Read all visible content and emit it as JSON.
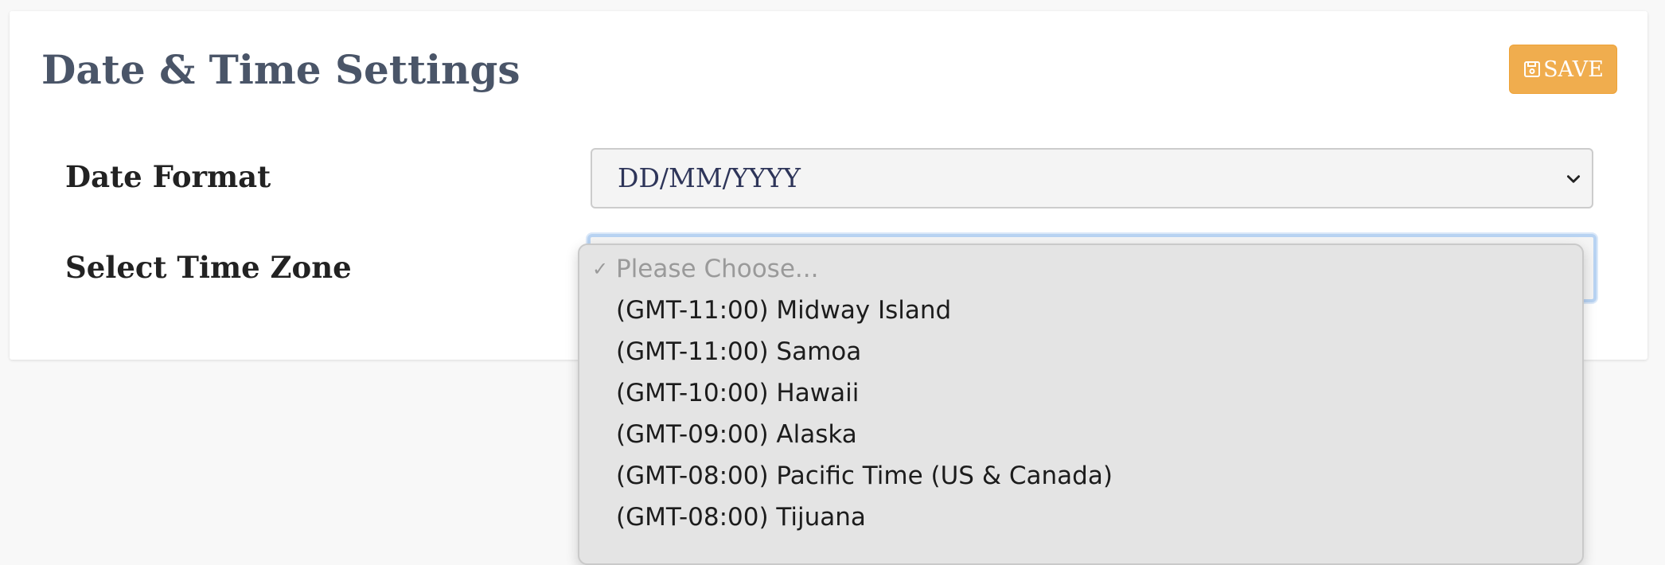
{
  "header": {
    "title": "Date & Time Settings",
    "save_label": "SAVE",
    "save_icon": "floppy-disk-icon",
    "save_color": "#f0ad4e"
  },
  "form": {
    "date_format": {
      "label": "Date Format",
      "value": "DD/MM/YYYY"
    },
    "time_zone": {
      "label": "Select Time Zone",
      "placeholder": "Please Choose...",
      "options": [
        "(GMT-11:00) Midway Island",
        "(GMT-11:00) Samoa",
        "(GMT-10:00) Hawaii",
        "(GMT-09:00) Alaska",
        "(GMT-08:00) Pacific Time (US & Canada)",
        "(GMT-08:00) Tijuana"
      ]
    }
  }
}
